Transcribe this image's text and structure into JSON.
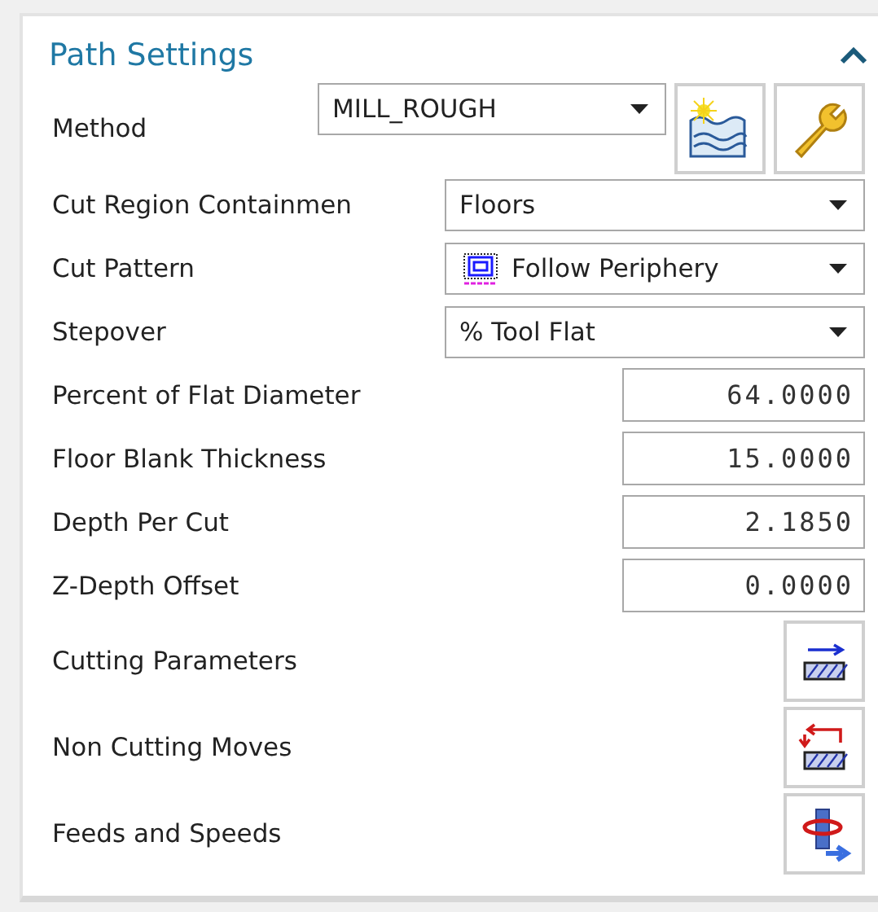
{
  "panel": {
    "title": "Path Settings",
    "expanded": true
  },
  "rows": [
    {
      "kind": "method",
      "label": "Method",
      "value": "MILL_ROUGH"
    },
    {
      "kind": "dropdown",
      "label": "Cut Region Containmen",
      "value": "Floors"
    },
    {
      "kind": "pattern",
      "label": "Cut Pattern",
      "value": "Follow Periphery"
    },
    {
      "kind": "dropdown",
      "label": "Stepover",
      "value": "% Tool Flat"
    },
    {
      "kind": "number",
      "label": "Percent of Flat Diameter",
      "value": "64.0000"
    },
    {
      "kind": "number",
      "label": "Floor Blank Thickness",
      "value": "15.0000"
    },
    {
      "kind": "number",
      "label": "Depth Per Cut",
      "value": "2.1850"
    },
    {
      "kind": "number",
      "label": "Z-Depth Offset",
      "value": "0.0000"
    },
    {
      "kind": "cutting",
      "label": "Cutting Parameters"
    },
    {
      "kind": "noncutting",
      "label": "Non Cutting Moves"
    },
    {
      "kind": "feeds",
      "label": "Feeds and Speeds"
    }
  ]
}
